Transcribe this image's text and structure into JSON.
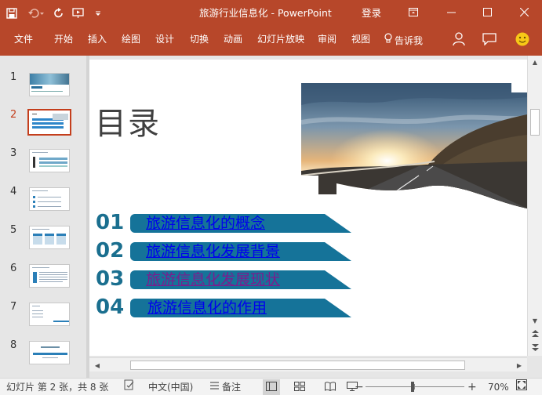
{
  "app": {
    "title": "旅游行业信息化 - PowerPoint",
    "login_label": "登录"
  },
  "ribbon": {
    "tabs": [
      "文件",
      "开始",
      "插入",
      "绘图",
      "设计",
      "切换",
      "动画",
      "幻灯片放映",
      "审阅",
      "视图"
    ],
    "tell_me": "告诉我"
  },
  "thumbnails": {
    "numbers": [
      "1",
      "2",
      "3",
      "4",
      "5",
      "6",
      "7",
      "8"
    ],
    "active_index": 2
  },
  "slide": {
    "title": "目录",
    "toc": [
      {
        "num": "01",
        "text": "旅游信息化的概念"
      },
      {
        "num": "02",
        "text": "旅游信息化发展背景"
      },
      {
        "num": "03",
        "text": "旅游信息化发展现状"
      },
      {
        "num": "04",
        "text": "旅游信息化的作用"
      }
    ]
  },
  "status": {
    "slide_info": "幻灯片 第 2 张，共 8 张",
    "language": "中文(中国)",
    "notes": "备注",
    "zoom": "70%"
  },
  "colors": {
    "accent": "#b7472a",
    "toc_number": "#1a6f8f",
    "toc_banner": "#157399",
    "link": "#0000ee",
    "visited_link": "#7b1e8e",
    "active_thumb_border": "#c43e1c"
  }
}
